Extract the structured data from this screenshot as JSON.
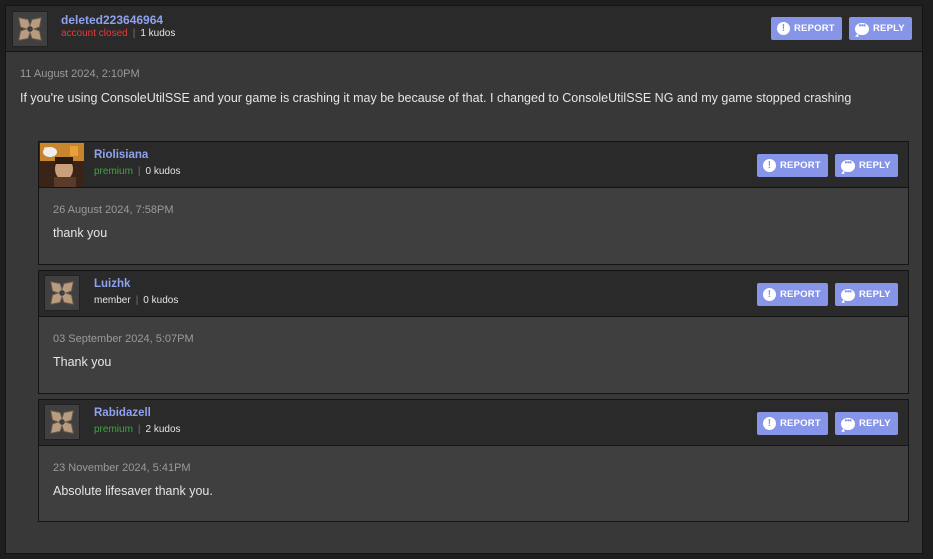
{
  "main_post": {
    "username": "deleted223646964",
    "status": "account closed",
    "kudos": "1 kudos",
    "date": "11 August 2024, 2:10PM",
    "text": "If you're using ConsoleUtilSSE and your game is crashing it may be because of that. I changed to ConsoleUtilSSE NG and my game stopped crashing"
  },
  "buttons": {
    "report": "REPORT",
    "reply": "REPLY"
  },
  "replies": [
    {
      "username": "Riolisiana",
      "status": "premium",
      "kudos": "0 kudos",
      "date": "26 August 2024, 7:58PM",
      "text": "thank you",
      "avatar": "photo-avatar"
    },
    {
      "username": "Luizhk",
      "status": "member",
      "kudos": "0 kudos",
      "date": "03 September 2024, 5:07PM",
      "text": "Thank you",
      "avatar": "default-avatar"
    },
    {
      "username": "Rabidazell",
      "status": "premium",
      "kudos": "2 kudos",
      "date": "23 November 2024, 5:41PM",
      "text": "Absolute lifesaver thank you.",
      "avatar": "default-avatar"
    }
  ],
  "colors": {
    "accent": "#8695e8",
    "username": "#8fa2ef",
    "account_closed": "#e83a3a",
    "premium": "#3ea63e",
    "background": "#383838"
  }
}
